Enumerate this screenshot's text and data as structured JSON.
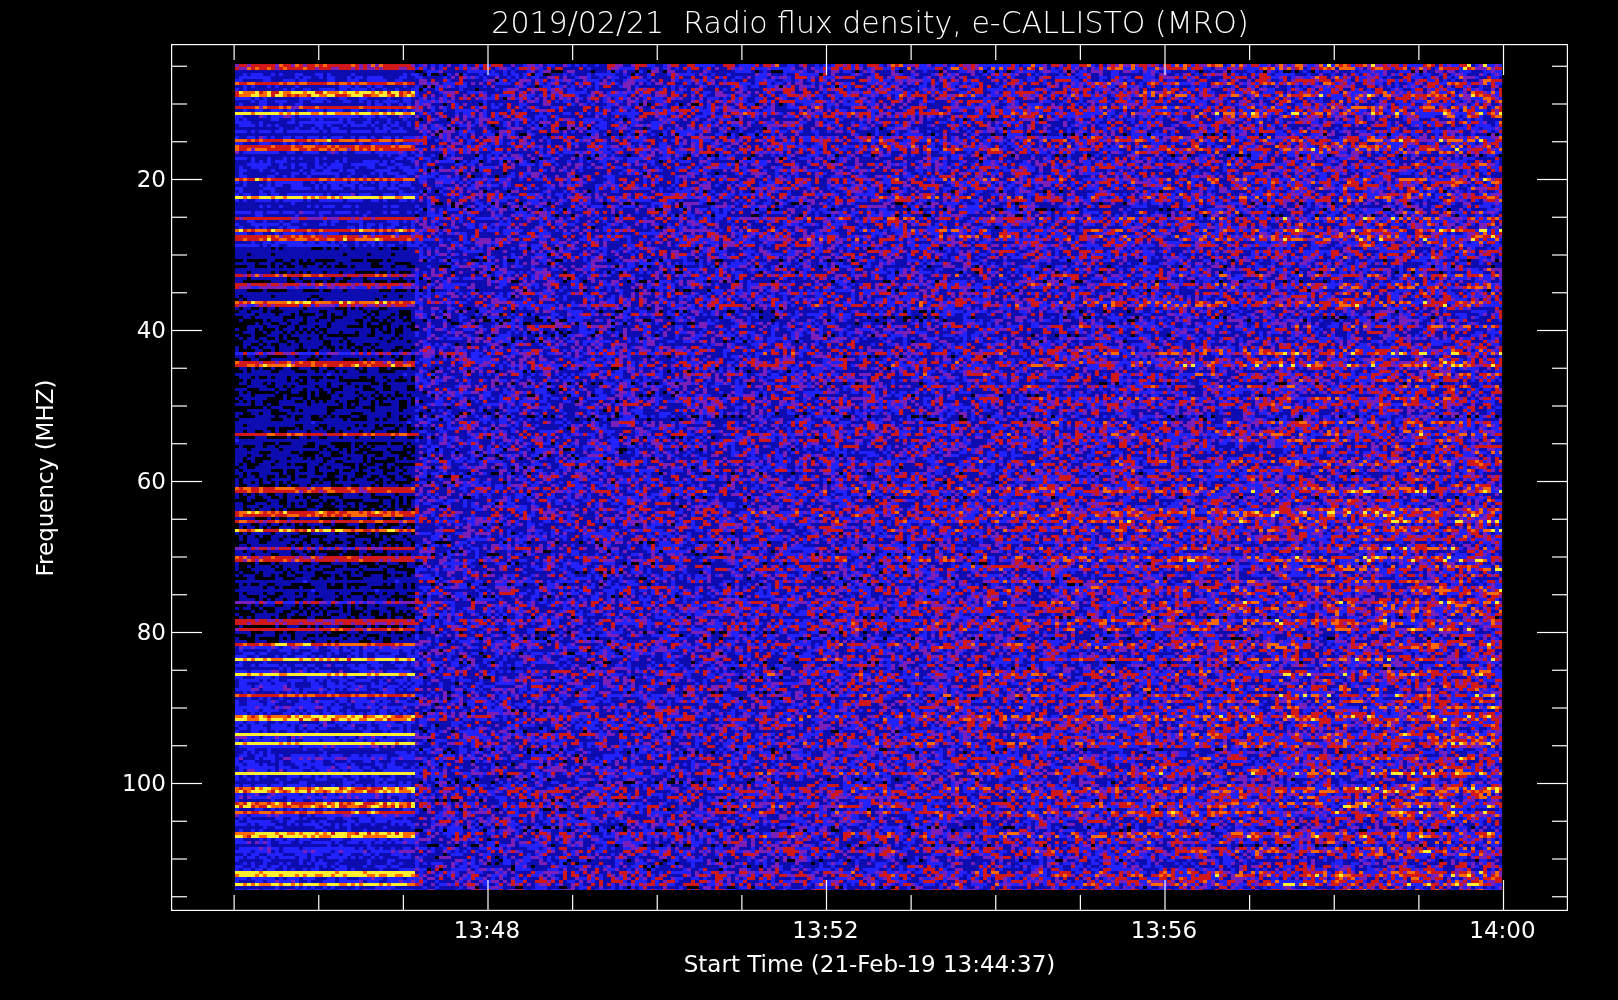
{
  "title": "2019/02/21  Radio flux density, e-CALLISTO (MRO)",
  "plot": {
    "y_axis": {
      "label": "Frequency (MHZ)",
      "ticks": [
        "20",
        "40",
        "60",
        "80",
        "100"
      ]
    },
    "x_axis": {
      "label": "Start Time (21-Feb-19 13:44:37)",
      "ticks": [
        "13:48",
        "13:52",
        "13:56",
        "14:00"
      ]
    }
  }
}
